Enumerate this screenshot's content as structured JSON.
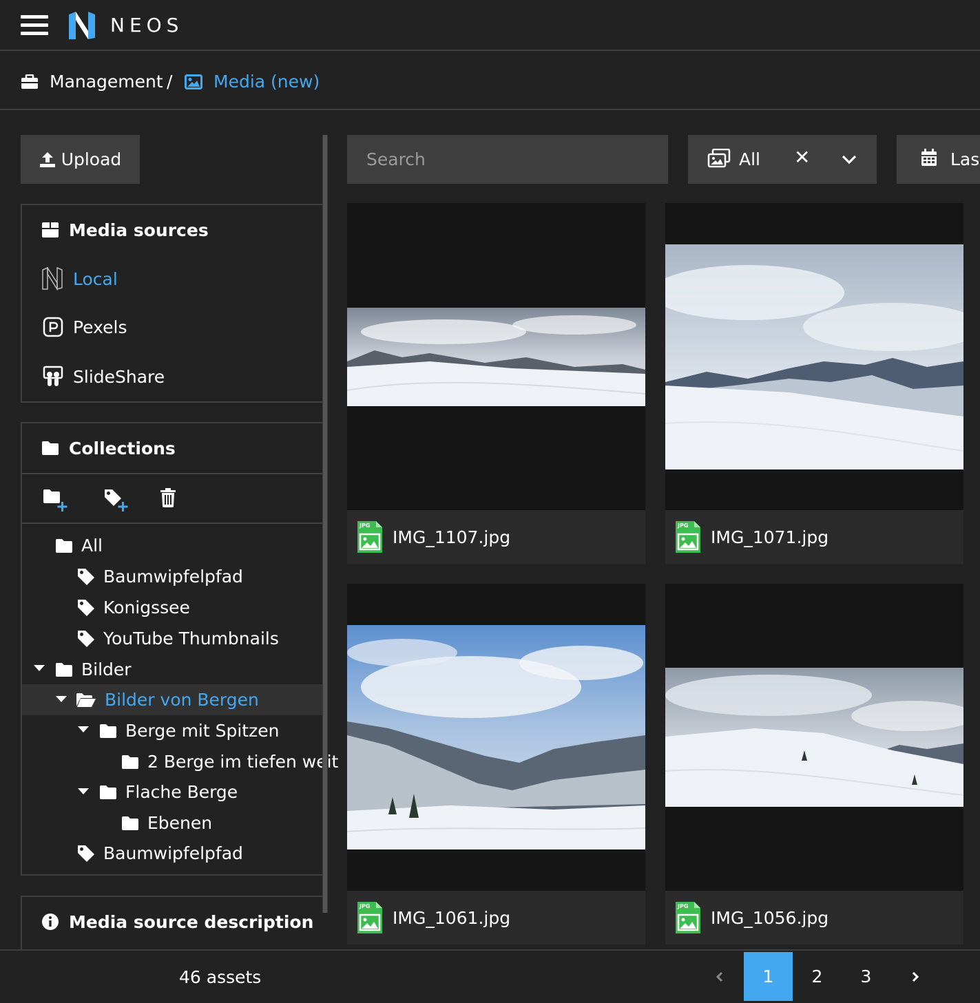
{
  "app": {
    "brand": "NEOS"
  },
  "breadcrumb": {
    "management": "Management",
    "separator": "/",
    "media": "Media (new)"
  },
  "toolbar": {
    "upload_label": "Upload",
    "search_placeholder": "Search",
    "filter_value": "All",
    "sort_label": "Last"
  },
  "media_sources": {
    "title": "Media sources",
    "items": [
      {
        "label": "Local",
        "icon": "neos-icon",
        "active": true
      },
      {
        "label": "Pexels",
        "icon": "pexels-icon",
        "active": false
      },
      {
        "label": "SlideShare",
        "icon": "slideshare-icon",
        "active": false
      }
    ]
  },
  "collections": {
    "title": "Collections",
    "items": [
      {
        "label": "All",
        "type": "folder"
      },
      {
        "label": "Baumwipfelpfad",
        "type": "tag"
      },
      {
        "label": "Konigssee",
        "type": "tag"
      },
      {
        "label": "YouTube Thumbnails",
        "type": "tag"
      },
      {
        "label": "Bilder",
        "type": "folder"
      },
      {
        "label": "Bilder von Bergen",
        "type": "folder-open",
        "active": true
      },
      {
        "label": "Berge mit Spitzen",
        "type": "folder"
      },
      {
        "label": "2 Berge im tiefen weit",
        "type": "folder"
      },
      {
        "label": "Flache Berge",
        "type": "folder"
      },
      {
        "label": "Ebenen",
        "type": "folder"
      },
      {
        "label": "Baumwipfelpfad",
        "type": "tag"
      }
    ]
  },
  "media_source_description": {
    "title": "Media source description"
  },
  "assets": [
    {
      "filename": "IMG_1107.jpg",
      "type_label": "JPG"
    },
    {
      "filename": "IMG_1071.jpg",
      "type_label": "JPG"
    },
    {
      "filename": "IMG_1061.jpg",
      "type_label": "JPG"
    },
    {
      "filename": "IMG_1056.jpg",
      "type_label": "JPG"
    }
  ],
  "footer": {
    "asset_count": "46 assets",
    "pages": [
      "1",
      "2",
      "3"
    ],
    "current_page": "1"
  },
  "colors": {
    "background": "#222222",
    "panel": "#3f3f3f",
    "accent": "#43a8f0",
    "file_icon": "#3dbd4f"
  }
}
